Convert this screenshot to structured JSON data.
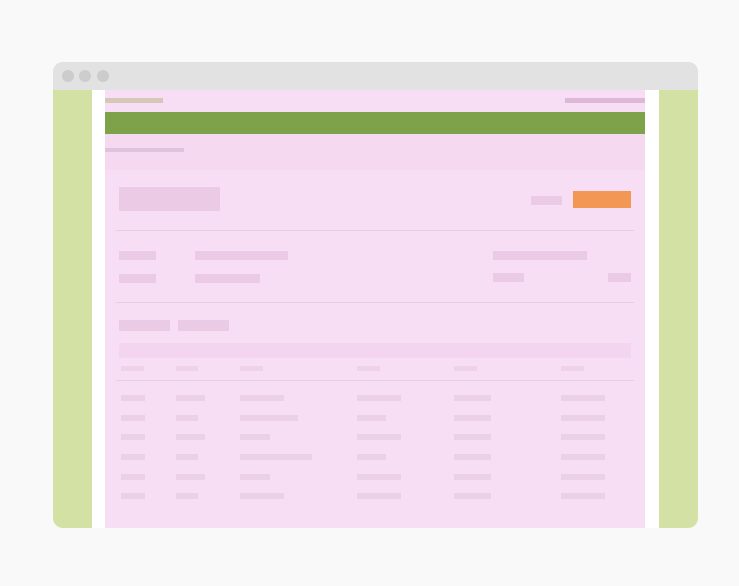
{
  "window": {
    "controls": [
      "close",
      "minimize",
      "maximize"
    ]
  },
  "colors": {
    "desktop": "#f9f9f9",
    "window_frame": "#d3e2a4",
    "titlebar": "#e2e2e2",
    "page_background": "#f7def5",
    "nav_bar": "#7ea24a",
    "primary_button": "#f39755",
    "placeholder": "#eacae4"
  },
  "page": {
    "utility_bar": {},
    "nav_bar": {},
    "breadcrumb": {},
    "header": {
      "title_placeholder": true,
      "secondary_action": {},
      "primary_action": {}
    },
    "details": {
      "fields": 2
    },
    "tabs": [
      "tab-1",
      "tab-2"
    ],
    "table": {
      "columns": 6,
      "rows": 6
    }
  }
}
